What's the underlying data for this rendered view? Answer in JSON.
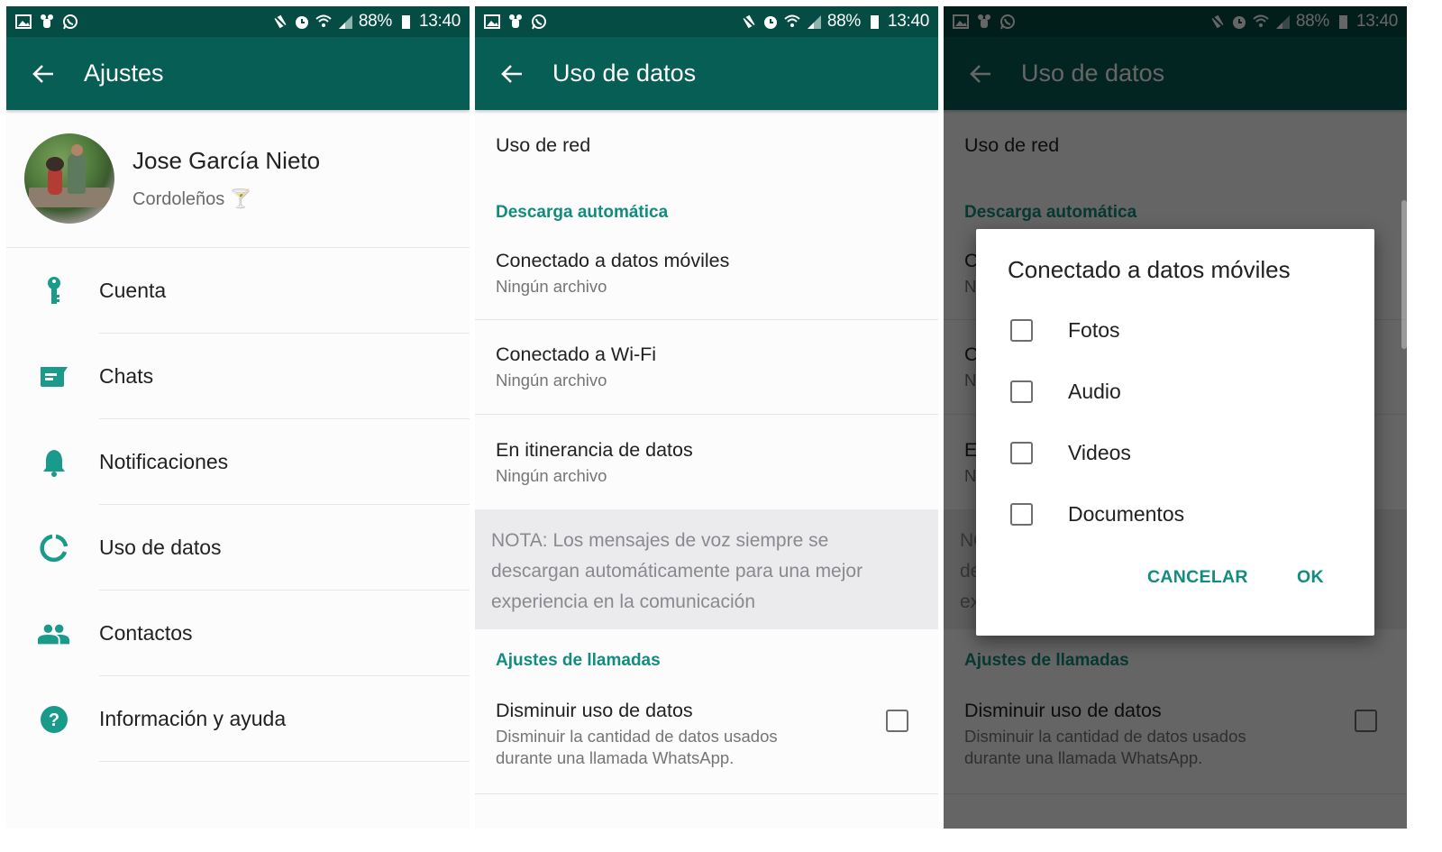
{
  "statusbar": {
    "battery": "88%",
    "time": "13:40",
    "left_icons": [
      "gallery-icon",
      "bug-icon",
      "whatsapp-icon"
    ],
    "right_icons": [
      "vibrate-mute-icon",
      "alarm-icon",
      "wifi-icon",
      "signal-icon",
      "battery-icon"
    ]
  },
  "colors": {
    "statusbar": "#054d44",
    "appbar": "#075e54",
    "accent": "#128c7e",
    "icon_teal": "#1a9a8a"
  },
  "settings": {
    "title": "Ajustes",
    "profile": {
      "name": "Jose García Nieto",
      "status": "Cordoleños 🍸"
    },
    "items": [
      {
        "label": "Cuenta",
        "icon": "key-icon"
      },
      {
        "label": "Chats",
        "icon": "chat-icon"
      },
      {
        "label": "Notificaciones",
        "icon": "bell-icon"
      },
      {
        "label": "Uso de datos",
        "icon": "data-usage-icon"
      },
      {
        "label": "Contactos",
        "icon": "contacts-icon"
      },
      {
        "label": "Información y ayuda",
        "icon": "help-icon"
      }
    ]
  },
  "data_usage": {
    "title": "Uso de datos",
    "network_usage": "Uso de red",
    "auto_download_header": "Descarga automática",
    "auto_download": [
      {
        "title": "Conectado a datos móviles",
        "value": "Ningún archivo"
      },
      {
        "title": "Conectado a Wi-Fi",
        "value": "Ningún archivo"
      },
      {
        "title": "En itinerancia de datos",
        "value": "Ningún archivo"
      }
    ],
    "note": "NOTA: Los mensajes de voz siempre se descargan automáticamente para una mejor experiencia en la comunicación",
    "calls_header": "Ajustes de llamadas",
    "low_data": {
      "title": "Disminuir uso de datos",
      "subtitle": "Disminuir la cantidad de datos usados durante una llamada WhatsApp.",
      "checked": false
    }
  },
  "dialog": {
    "title": "Conectado a datos móviles",
    "options": [
      {
        "label": "Fotos",
        "checked": false
      },
      {
        "label": "Audio",
        "checked": false
      },
      {
        "label": "Videos",
        "checked": false
      },
      {
        "label": "Documentos",
        "checked": false
      }
    ],
    "cancel": "CANCELAR",
    "ok": "OK"
  }
}
